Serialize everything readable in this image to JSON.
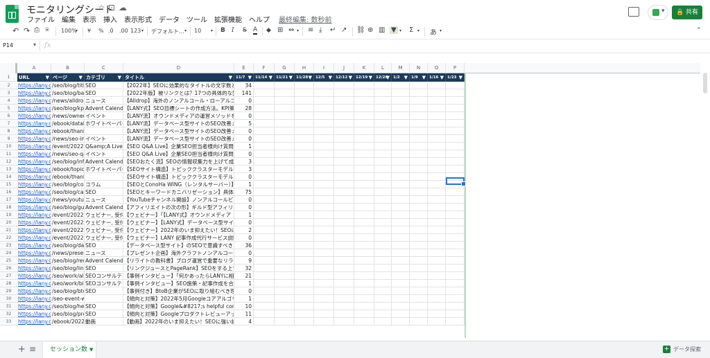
{
  "app": {
    "title": "モニタリングシート",
    "menu": [
      "ファイル",
      "編集",
      "表示",
      "挿入",
      "表示形式",
      "データ",
      "ツール",
      "拡張機能",
      "ヘルプ"
    ],
    "last_edit": "最終編集: 数秒前",
    "share_label": "共有"
  },
  "toolbar": {
    "zoom": "100%",
    "currency": "¥",
    "percent": "%",
    "dec_decrease": ".0",
    "dec_increase": ".00",
    "more_formats": "123",
    "font": "デフォルト...",
    "font_size": "10",
    "bold": "B",
    "italic": "I",
    "strike": "S",
    "text_color": "A",
    "function": "Σ",
    "input_tools": "あ"
  },
  "formula_bar": {
    "cell_ref": "P14",
    "fx": "fx",
    "content": ""
  },
  "columns": [
    "A",
    "B",
    "C",
    "D",
    "E",
    "F",
    "G",
    "H",
    "I",
    "J",
    "K",
    "L",
    "M",
    "N",
    "O",
    "P"
  ],
  "header_row": [
    "URL",
    "ページ",
    "カテゴリ",
    "タイトル",
    "11/7",
    "11/14",
    "11/21",
    "11/28",
    "12/5",
    "12/12",
    "12/19",
    "12/26",
    "1/2",
    "1/9",
    "1/16",
    "1/23"
  ],
  "rows": [
    {
      "n": "2",
      "url": "https://lany.c",
      "page": "/seo/blog/title-tag",
      "cat": "SEO",
      "title": "【2022年】SEOに効果的なタイトルの文字数と",
      "v": "34"
    },
    {
      "n": "3",
      "url": "https://lany.c",
      "page": "/seo/blog/backlin",
      "cat": "SEO",
      "title": "【2022年版】被リンクとは？17つの具体的な獲",
      "v": "141"
    },
    {
      "n": "4",
      "url": "https://lany.c",
      "page": "/news/alldrop-no",
      "cat": "ニュース",
      "title": "【Alldrop】海外のノンアルコール・ローアルコー",
      "v": "0"
    },
    {
      "n": "5",
      "url": "https://lany.c",
      "page": "/seo/blog/kpi-she",
      "cat": "Advent Calendar",
      "title": "【LANY式】SEO目標シートの作成方法。KPI策",
      "v": "28"
    },
    {
      "n": "6",
      "url": "https://lany.c",
      "page": "/news/owned-me",
      "cat": "イベント",
      "title": "【LANY流】オウンドメディアの運営メソッドを",
      "v": "0"
    },
    {
      "n": "7",
      "url": "https://lany.c",
      "page": "/ebook/database",
      "cat": "ホワイトペーパー",
      "title": "【LANY流】データベース型サイトのSEO改善メ",
      "v": "5"
    },
    {
      "n": "8",
      "url": "https://lany.c",
      "page": "/ebook/thanks/da",
      "cat": "",
      "title": "【LANY流】データベース型サイトのSEO改善メ",
      "v": "0"
    },
    {
      "n": "9",
      "url": "https://lany.c",
      "page": "/news/seo-impro",
      "cat": "イベント",
      "title": "【LANY流】データベース型サイトのSEO改善メ",
      "v": "0"
    },
    {
      "n": "10",
      "url": "https://lany.c",
      "page": "/event/20221019",
      "cat": "Q&amp;A Live, S",
      "title": "【SEO Q&A Live】企業SEO担当者様向け質問会",
      "v": "1"
    },
    {
      "n": "11",
      "url": "https://lany.c",
      "page": "/news/seo-qa-liv",
      "cat": "イベント",
      "title": "【SEO Q&A Live】企業SEO担当者様向け質問会",
      "v": "0"
    },
    {
      "n": "12",
      "url": "https://lany.c",
      "page": "/seo/blog/informa",
      "cat": "Advent Calendar",
      "title": "【SEOおたく流】SEOの情報収集力を上げて成",
      "v": "3"
    },
    {
      "n": "13",
      "url": "https://lany.c",
      "page": "/ebook/topic-clus",
      "cat": "ホワイトペーパー",
      "title": "【SEOサイト構造】トピッククラスターモデルと",
      "v": "3"
    },
    {
      "n": "14",
      "url": "https://lany.c",
      "page": "/ebook/thanks/to",
      "cat": "",
      "title": "【SEOサイト構造】トピッククラスターモデルと",
      "v": "0"
    },
    {
      "n": "15",
      "url": "https://lany.c",
      "page": "/seo/blog/conoha",
      "cat": "コラム",
      "title": "【SEOとConoHa WING（レンタルサーバー）】",
      "v": "1"
    },
    {
      "n": "16",
      "url": "https://lany.c",
      "page": "/seo/blog/cannib",
      "cat": "SEO",
      "title": "【SEOとキーワードカニバリゼーション】具体的",
      "v": "75"
    },
    {
      "n": "17",
      "url": "https://lany.c",
      "page": "/news/youtube-c",
      "cat": "ニュース",
      "title": "【YouTubeチャンネル開設】ノンアルコールビー",
      "v": "0"
    },
    {
      "n": "18",
      "url": "https://lany.c",
      "page": "/seo/blog/guild-a",
      "cat": "Advent Calendar",
      "title": "【アフィリエイトの次の形】ギルド型アフィリエ",
      "v": "0"
    },
    {
      "n": "19",
      "url": "https://lany.c",
      "page": "/event/20221005",
      "cat": "ウェビナー, 受付",
      "title": "【ウェビナー】「【LANY式】オウンドメディア",
      "v": "1"
    },
    {
      "n": "20",
      "url": "https://lany.c",
      "page": "/event/20220907",
      "cat": "ウェビナー, 受付",
      "title": "【ウェビナー】【LANY式】データベース型サイ",
      "v": "0"
    },
    {
      "n": "21",
      "url": "https://lany.c",
      "page": "/event/20220824",
      "cat": "ウェビナー, 受付",
      "title": "【ウェビナー】2022年のいま抑えたい！SEOに",
      "v": "2"
    },
    {
      "n": "22",
      "url": "https://lany.c",
      "page": "/event/20221109",
      "cat": "ウェビナー, 受付",
      "title": "【ウェビナー】LANY 記事作成代行サービス説明",
      "v": "0"
    },
    {
      "n": "23",
      "url": "https://lany.c",
      "page": "/seo/blog/databa",
      "cat": "SEO",
      "title": "【データベース型サイト】のSEOで意識すべき",
      "v": "36"
    },
    {
      "n": "24",
      "url": "https://lany.c",
      "page": "/news/present-ca",
      "cat": "ニュース",
      "title": "【プレゼント企画】海外クラフトノンアルコール",
      "v": "0"
    },
    {
      "n": "25",
      "url": "https://lany.c",
      "page": "/seo/blog/rewrite",
      "cat": "Advent Calendar",
      "title": "【リライトの教科書】ブログ運営で重要なリライ",
      "v": "9"
    },
    {
      "n": "26",
      "url": "https://lany.c",
      "page": "/seo/blog/link-jui",
      "cat": "SEO",
      "title": "【リンクジュースとPageRank】SEOをする上で",
      "v": "32"
    },
    {
      "n": "27",
      "url": "https://lany.c",
      "page": "/seo/work/allabo",
      "cat": "SEOコンサルテ",
      "title": "【事例インタビュー】「何かあったらLANYに相",
      "v": "21"
    },
    {
      "n": "28",
      "url": "https://lany.c",
      "page": "/seo/work/bizma",
      "cat": "SEOコンサルテ",
      "title": "【事例インタビュー】SEO施策・記事作成を合",
      "v": "1"
    },
    {
      "n": "29",
      "url": "https://lany.c",
      "page": "/seo/blog/btob-se",
      "cat": "SEO",
      "title": "【事例付き】BtoB企業がSEOに取り組むべき理",
      "v": "0"
    },
    {
      "n": "30",
      "url": "https://lany.c",
      "page": "/seo-event-webir",
      "cat": "",
      "title": "【傾向と対策】2022年5月Googleコアアルゴリズ",
      "v": "1"
    },
    {
      "n": "31",
      "url": "https://lany.c",
      "page": "/seo/blog/helpful",
      "cat": "SEO",
      "title": "【傾向と対策】Google&#8217;s helpful content",
      "v": "10"
    },
    {
      "n": "32",
      "url": "https://lany.c",
      "page": "/seo/blog/produc",
      "cat": "SEO",
      "title": "【傾向と対策】Googleプロダクトレビューアップ",
      "v": "11"
    },
    {
      "n": "33",
      "url": "https://lany.c",
      "page": "/ebook/2022082",
      "cat": "動画",
      "title": "【動画】2022年のいま抑えたい！SEOに強い記",
      "v": "4"
    }
  ],
  "sheet": {
    "tab_name": "セッション数",
    "explore_label": "データ探索"
  },
  "colors": {
    "header_bg": "#1c3a5b",
    "brand_green": "#188038",
    "link": "#1155cc",
    "selection": "#1a73e8"
  }
}
